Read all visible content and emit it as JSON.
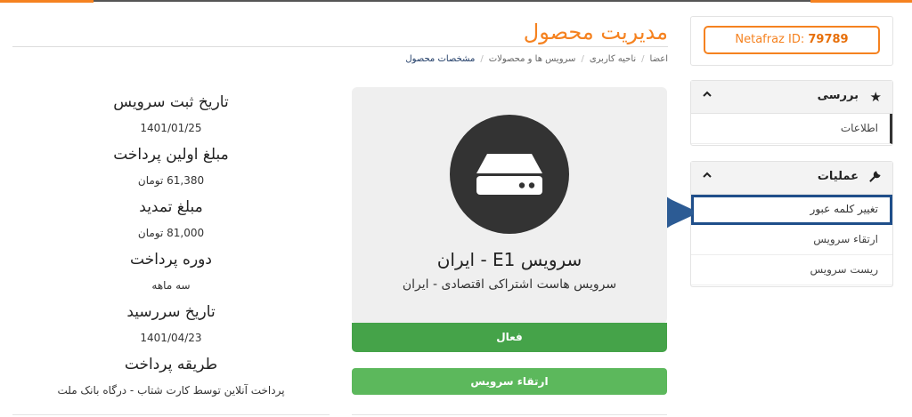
{
  "id_box": {
    "label": "Netafraz ID:",
    "value": "79789"
  },
  "sidebar": {
    "review": {
      "title": "بررسی",
      "items": [
        {
          "label": "اطلاعات"
        }
      ]
    },
    "actions": {
      "title": "عملیات",
      "items": [
        {
          "label": "تغییر کلمه عبور",
          "highlighted": true
        },
        {
          "label": "ارتقاء سرویس"
        },
        {
          "label": "ریست سرویس"
        }
      ]
    }
  },
  "header": {
    "title": "مدیریت محصول"
  },
  "breadcrumb": [
    "اعضا",
    "ناحیه کاربری",
    "سرویس ها و محصولات",
    "مشخصات محصول"
  ],
  "product": {
    "name": "سرویس E1 - ایران",
    "group": "سرویس هاست اشتراکی اقتصادی - ایران",
    "status": "فعال",
    "upgrade_label": "ارتقاء سرویس"
  },
  "info": {
    "reg_date_label": "تاریخ ثبت سرویس",
    "reg_date": "1401/01/25",
    "first_payment_label": "مبلغ اولین پرداخت",
    "first_payment": "61,380 تومان",
    "renewal_label": "مبلغ تمدید",
    "renewal": "81,000 تومان",
    "cycle_label": "دوره پرداخت",
    "cycle": "سه ماهه",
    "due_label": "تاریخ سررسید",
    "due": "1401/04/23",
    "method_label": "طریقه پرداخت",
    "method": "پرداخت آنلاین توسط کارت شتاب - درگاه بانک ملت"
  },
  "colors": {
    "accent": "#f58220",
    "success": "#45a349",
    "highlight": "#1f4e8a"
  }
}
